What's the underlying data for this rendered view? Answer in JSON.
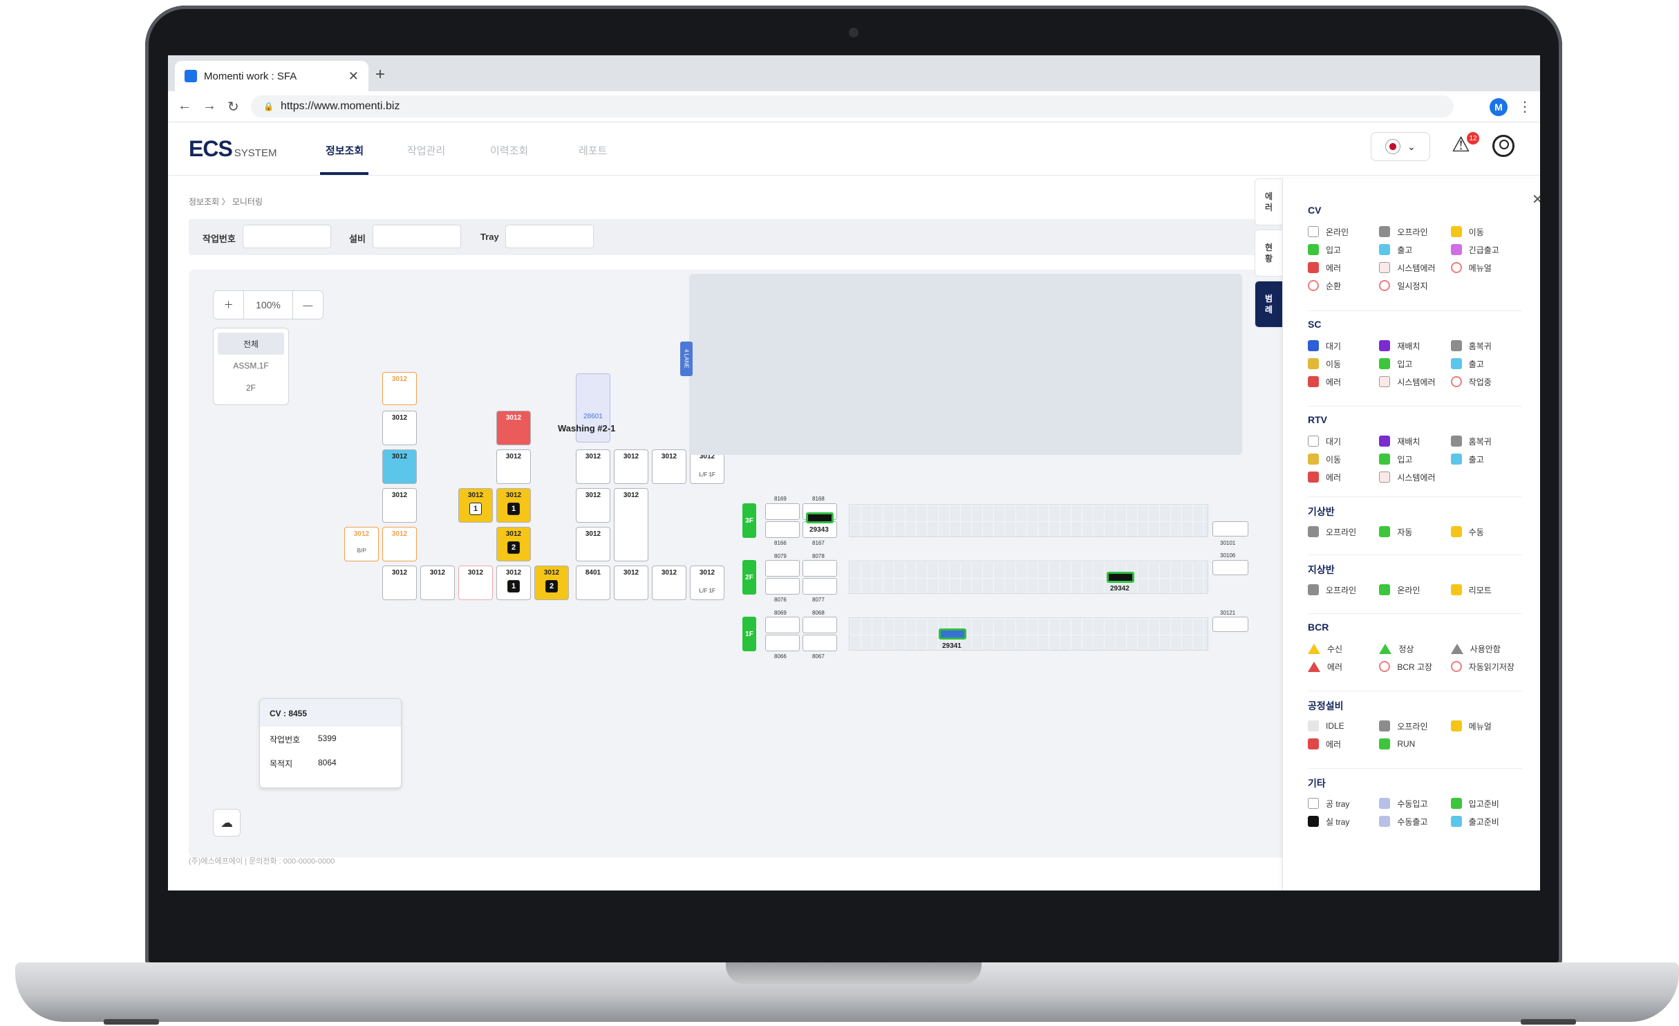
{
  "browser": {
    "tab_title": "Momenti work : SFA",
    "url": "https://www.momenti.biz",
    "profile_initial": "M"
  },
  "app": {
    "logo": "ECS",
    "logo_sub": "SYSTEM",
    "menu": [
      "정보조회",
      "작업관리",
      "이력조회",
      "레포트"
    ],
    "alert_count": "12"
  },
  "page": {
    "breadcrumb": "정보조회 〉 모니터링",
    "filters": {
      "job_no_label": "작업번호",
      "equip_label": "설비",
      "tray_label": "Tray"
    },
    "zoom": "100%",
    "floors": [
      "전체",
      "ASSM,1F",
      "2F"
    ],
    "footer": "(주)에스에프에이 | 문의전화 : 000-0000-0000"
  },
  "map": {
    "cv_code": "3012",
    "bp_label": "B/P",
    "washing_code": "28601",
    "washing_label": "Washing #2-1",
    "cv_8401": "8401",
    "lf_label": "L/F 1F",
    "lanes_label": "4 LANE",
    "floor_labels": [
      "3F",
      "2F",
      "1F"
    ],
    "slot_numbers": [
      "8169",
      "8168",
      "8166",
      "8167",
      "8079",
      "8078",
      "8076",
      "8077",
      "8069",
      "8068",
      "8066",
      "8067"
    ],
    "end_codes": [
      "30101",
      "30106",
      "30121"
    ],
    "rtv_labels": [
      "29343",
      "29342",
      "29341"
    ]
  },
  "tooltip": {
    "title": "CV : 8455",
    "rows": [
      {
        "k": "작업번호",
        "v": "5399"
      },
      {
        "k": "목적지",
        "v": "8064"
      }
    ]
  },
  "legend": {
    "tabs": [
      "에러",
      "현황",
      "범례"
    ],
    "sections": [
      {
        "title": "CV",
        "items": [
          {
            "label": "온라인",
            "color": "#ffffff"
          },
          {
            "label": "오프라인",
            "color": "#8c8c8c"
          },
          {
            "label": "이동",
            "color": "#f5c518"
          },
          {
            "label": "입고",
            "color": "#3cc63c"
          },
          {
            "label": "출고",
            "color": "#5bc6ea"
          },
          {
            "label": "긴급출고",
            "color": "#d06ee6"
          },
          {
            "label": "에러",
            "color": "#e04848"
          },
          {
            "label": "시스템에러",
            "color": "#fde8e8"
          },
          {
            "label": "메뉴얼",
            "color": "circle"
          },
          {
            "label": "순환",
            "color": "circle"
          },
          {
            "label": "일시정지",
            "color": "circle"
          }
        ]
      },
      {
        "title": "SC",
        "items": [
          {
            "label": "대기",
            "color": "#2f5fd6"
          },
          {
            "label": "재배치",
            "color": "#7b2bd0"
          },
          {
            "label": "홈복귀",
            "color": "#8c8c8c"
          },
          {
            "label": "이동",
            "color": "#e2b83a"
          },
          {
            "label": "입고",
            "color": "#3cc63c"
          },
          {
            "label": "출고",
            "color": "#5bc6ea"
          },
          {
            "label": "에러",
            "color": "#e04848"
          },
          {
            "label": "시스템에러",
            "color": "#fde8e8"
          },
          {
            "label": "작업중",
            "color": "circle"
          }
        ]
      },
      {
        "title": "RTV",
        "items": [
          {
            "label": "대기",
            "color": "#ffffff"
          },
          {
            "label": "재배치",
            "color": "#7b2bd0"
          },
          {
            "label": "홈복귀",
            "color": "#8c8c8c"
          },
          {
            "label": "이동",
            "color": "#e2b83a"
          },
          {
            "label": "입고",
            "color": "#3cc63c"
          },
          {
            "label": "출고",
            "color": "#5bc6ea"
          },
          {
            "label": "에러",
            "color": "#e04848"
          },
          {
            "label": "시스템에러",
            "color": "#fde8e8"
          }
        ]
      },
      {
        "title": "기상반",
        "items": [
          {
            "label": "오프라인",
            "color": "#8c8c8c"
          },
          {
            "label": "자동",
            "color": "#3cc63c"
          },
          {
            "label": "수동",
            "color": "#f5c518"
          }
        ]
      },
      {
        "title": "지상반",
        "items": [
          {
            "label": "오프라인",
            "color": "#8c8c8c"
          },
          {
            "label": "온라인",
            "color": "#3cc63c"
          },
          {
            "label": "리모트",
            "color": "#f5c518"
          }
        ]
      },
      {
        "title": "BCR",
        "items": [
          {
            "label": "수신",
            "color": "tri-yellow"
          },
          {
            "label": "정상",
            "color": "tri-green"
          },
          {
            "label": "사용안함",
            "color": "tri-gray"
          },
          {
            "label": "에러",
            "color": "tri-red"
          },
          {
            "label": "BCR 고장",
            "color": "circle"
          },
          {
            "label": "자동읽기저장",
            "color": "circle"
          }
        ]
      },
      {
        "title": "공정설비",
        "items": [
          {
            "label": "IDLE",
            "color": "#e6e6e6"
          },
          {
            "label": "오프라인",
            "color": "#8c8c8c"
          },
          {
            "label": "메뉴얼",
            "color": "#f5c518"
          },
          {
            "label": "에러",
            "color": "#e04848"
          },
          {
            "label": "RUN",
            "color": "#3cc63c"
          }
        ]
      },
      {
        "title": "기타",
        "items": [
          {
            "label": "공 tray",
            "color": "#ffffff"
          },
          {
            "label": "수동입고",
            "color": "#b9c0e8"
          },
          {
            "label": "입고준비",
            "color": "#3cc63c"
          },
          {
            "label": "실 tray",
            "color": "#111111"
          },
          {
            "label": "수동출고",
            "color": "#b9c0e8"
          },
          {
            "label": "출고준비",
            "color": "#5bc6ea"
          }
        ]
      }
    ]
  }
}
